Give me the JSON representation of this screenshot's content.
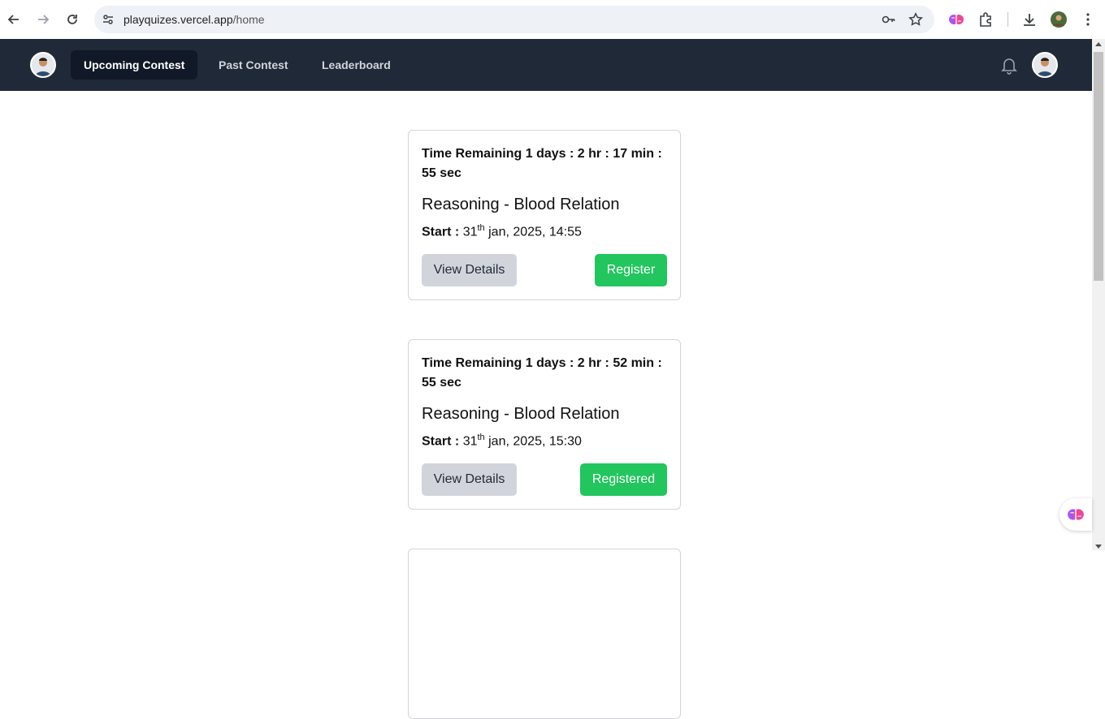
{
  "browser": {
    "url_host": "playquizes.vercel.app",
    "url_path": "/home"
  },
  "nav": {
    "links": [
      {
        "label": "Upcoming Contest",
        "active": true
      },
      {
        "label": "Past Contest",
        "active": false
      },
      {
        "label": "Leaderboard",
        "active": false
      }
    ]
  },
  "cards": [
    {
      "time_remaining": "Time Remaining 1 days : 2 hr : 17 min : 55 sec",
      "title": "Reasoning - Blood Relation",
      "start_label": "Start :",
      "start_day": "31",
      "start_suffix": "th",
      "start_rest": "jan, 2025, 14:55",
      "view_label": "View Details",
      "action_label": "Register"
    },
    {
      "time_remaining": "Time Remaining 1 days : 2 hr : 52 min : 55 sec",
      "title": "Reasoning - Blood Relation",
      "start_label": "Start :",
      "start_day": "31",
      "start_suffix": "th",
      "start_rest": "jan, 2025, 15:30",
      "view_label": "View Details",
      "action_label": "Registered"
    }
  ],
  "colors": {
    "nav_bg": "#1f2937",
    "active_tab": "#111827",
    "accent_green": "#22c55e",
    "view_btn": "#d1d5db"
  }
}
